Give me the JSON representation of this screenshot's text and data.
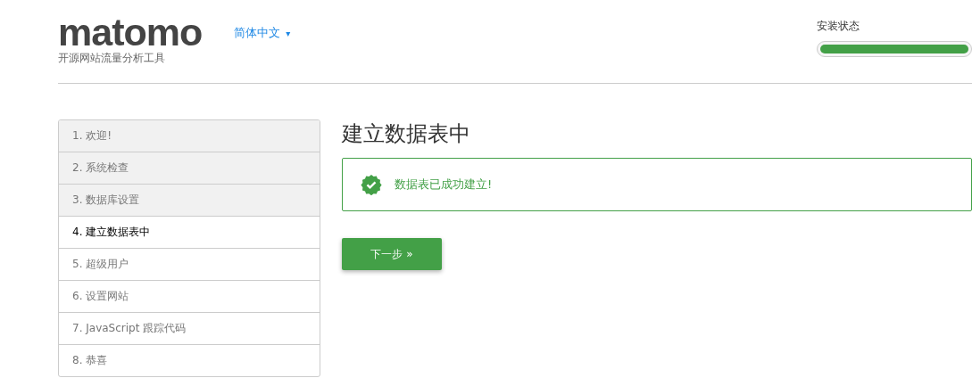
{
  "logo": {
    "wordmark": "matomo",
    "tagline": "开源网站流量分析工具"
  },
  "language": {
    "label": "简体中文",
    "caret": "▾"
  },
  "install_status": {
    "label": "安装状态",
    "level": 1
  },
  "steps": [
    {
      "label": "1. 欢迎!",
      "completed": true,
      "selected": false
    },
    {
      "label": "2. 系统检查",
      "completed": true,
      "selected": false
    },
    {
      "label": "3. 数据库设置",
      "completed": true,
      "selected": false
    },
    {
      "label": "4. 建立数据表中",
      "completed": false,
      "selected": true
    },
    {
      "label": "5. 超级用户",
      "completed": false,
      "selected": false
    },
    {
      "label": "6. 设置网站",
      "completed": false,
      "selected": false
    },
    {
      "label": "7. JavaScript 跟踪代码",
      "completed": false,
      "selected": false
    },
    {
      "label": "8. 恭喜",
      "completed": false,
      "selected": false
    }
  ],
  "content": {
    "title": "建立数据表中",
    "alert": {
      "kind": "success",
      "text": "数据表已成功建立!"
    },
    "next_button": "下一步 »"
  }
}
